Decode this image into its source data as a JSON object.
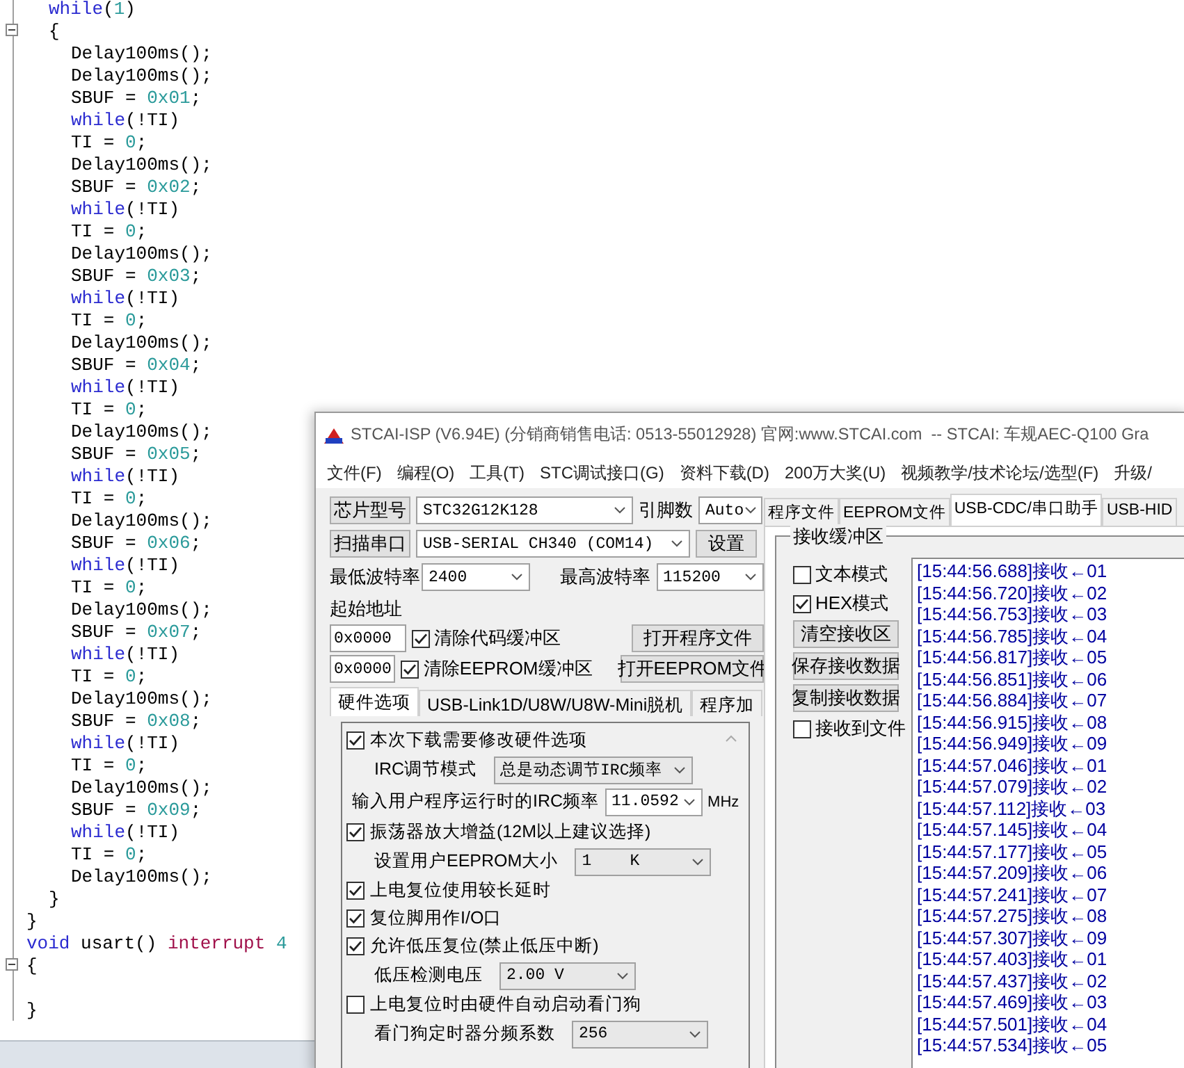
{
  "code": {
    "lines": [
      {
        "children": [
          {
            "tokens": [
              {
                "text": "while",
                "kind": "keyword"
              },
              {
                "text": "(",
                "kind": "plain"
              },
              {
                "text": "1",
                "kind": "number"
              },
              {
                "text": ")",
                "kind": "plain"
              }
            ]
          },
          {
            "tokens": [
              {
                "text": "{",
                "kind": "plain"
              }
            ],
            "expanded": true,
            "children": [
              {
                "tokens": [
                  {
                    "text": "Delay100ms();",
                    "kind": "plain"
                  }
                ]
              },
              {
                "tokens": [
                  {
                    "text": "Delay100ms();",
                    "kind": "plain"
                  }
                ]
              },
              {
                "tokens": [
                  {
                    "text": "SBUF = ",
                    "kind": "plain"
                  },
                  {
                    "text": "0x01",
                    "kind": "number"
                  },
                  {
                    "text": ";",
                    "kind": "plain"
                  }
                ]
              },
              {
                "tokens": [
                  {
                    "text": "while",
                    "kind": "keyword"
                  },
                  {
                    "text": "(!TI)",
                    "kind": "plain"
                  }
                ]
              },
              {
                "tokens": [
                  {
                    "text": "TI = ",
                    "kind": "plain"
                  },
                  {
                    "text": "0",
                    "kind": "number"
                  },
                  {
                    "text": ";",
                    "kind": "plain"
                  }
                ]
              },
              {
                "tokens": [
                  {
                    "text": "Delay100ms();",
                    "kind": "plain"
                  }
                ]
              },
              {
                "tokens": [
                  {
                    "text": "SBUF = ",
                    "kind": "plain"
                  },
                  {
                    "text": "0x02",
                    "kind": "number"
                  },
                  {
                    "text": ";",
                    "kind": "plain"
                  }
                ]
              },
              {
                "tokens": [
                  {
                    "text": "while",
                    "kind": "keyword"
                  },
                  {
                    "text": "(!TI)",
                    "kind": "plain"
                  }
                ]
              },
              {
                "tokens": [
                  {
                    "text": "TI = ",
                    "kind": "plain"
                  },
                  {
                    "text": "0",
                    "kind": "number"
                  },
                  {
                    "text": ";",
                    "kind": "plain"
                  }
                ]
              },
              {
                "tokens": [
                  {
                    "text": "Delay100ms();",
                    "kind": "plain"
                  }
                ]
              },
              {
                "tokens": [
                  {
                    "text": "SBUF = ",
                    "kind": "plain"
                  },
                  {
                    "text": "0x03",
                    "kind": "number"
                  },
                  {
                    "text": ";",
                    "kind": "plain"
                  }
                ]
              },
              {
                "tokens": [
                  {
                    "text": "while",
                    "kind": "keyword"
                  },
                  {
                    "text": "(!TI)",
                    "kind": "plain"
                  }
                ]
              },
              {
                "tokens": [
                  {
                    "text": "TI = ",
                    "kind": "plain"
                  },
                  {
                    "text": "0",
                    "kind": "number"
                  },
                  {
                    "text": ";",
                    "kind": "plain"
                  }
                ]
              },
              {
                "tokens": [
                  {
                    "text": "Delay100ms();",
                    "kind": "plain"
                  }
                ]
              },
              {
                "tokens": [
                  {
                    "text": "SBUF = ",
                    "kind": "plain"
                  },
                  {
                    "text": "0x04",
                    "kind": "number"
                  },
                  {
                    "text": ";",
                    "kind": "plain"
                  }
                ]
              },
              {
                "tokens": [
                  {
                    "text": "while",
                    "kind": "keyword"
                  },
                  {
                    "text": "(!TI)",
                    "kind": "plain"
                  }
                ]
              },
              {
                "tokens": [
                  {
                    "text": "TI = ",
                    "kind": "plain"
                  },
                  {
                    "text": "0",
                    "kind": "number"
                  },
                  {
                    "text": ";",
                    "kind": "plain"
                  }
                ]
              },
              {
                "tokens": [
                  {
                    "text": "Delay100ms();",
                    "kind": "plain"
                  }
                ]
              },
              {
                "tokens": [
                  {
                    "text": "SBUF = ",
                    "kind": "plain"
                  },
                  {
                    "text": "0x05",
                    "kind": "number"
                  },
                  {
                    "text": ";",
                    "kind": "plain"
                  }
                ]
              },
              {
                "tokens": [
                  {
                    "text": "while",
                    "kind": "keyword"
                  },
                  {
                    "text": "(!TI)",
                    "kind": "plain"
                  }
                ]
              },
              {
                "tokens": [
                  {
                    "text": "TI = ",
                    "kind": "plain"
                  },
                  {
                    "text": "0",
                    "kind": "number"
                  },
                  {
                    "text": ";",
                    "kind": "plain"
                  }
                ]
              },
              {
                "tokens": [
                  {
                    "text": "Delay100ms();",
                    "kind": "plain"
                  }
                ]
              },
              {
                "tokens": [
                  {
                    "text": "SBUF = ",
                    "kind": "plain"
                  },
                  {
                    "text": "0x06",
                    "kind": "number"
                  },
                  {
                    "text": ";",
                    "kind": "plain"
                  }
                ]
              },
              {
                "tokens": [
                  {
                    "text": "while",
                    "kind": "keyword"
                  },
                  {
                    "text": "(!TI)",
                    "kind": "plain"
                  }
                ]
              },
              {
                "tokens": [
                  {
                    "text": "TI = ",
                    "kind": "plain"
                  },
                  {
                    "text": "0",
                    "kind": "number"
                  },
                  {
                    "text": ";",
                    "kind": "plain"
                  }
                ]
              },
              {
                "tokens": [
                  {
                    "text": "Delay100ms();",
                    "kind": "plain"
                  }
                ]
              },
              {
                "tokens": [
                  {
                    "text": "SBUF = ",
                    "kind": "plain"
                  },
                  {
                    "text": "0x07",
                    "kind": "number"
                  },
                  {
                    "text": ";",
                    "kind": "plain"
                  }
                ]
              },
              {
                "tokens": [
                  {
                    "text": "while",
                    "kind": "keyword"
                  },
                  {
                    "text": "(!TI)",
                    "kind": "plain"
                  }
                ]
              },
              {
                "tokens": [
                  {
                    "text": "TI = ",
                    "kind": "plain"
                  },
                  {
                    "text": "0",
                    "kind": "number"
                  },
                  {
                    "text": ";",
                    "kind": "plain"
                  }
                ]
              },
              {
                "tokens": [
                  {
                    "text": "Delay100ms();",
                    "kind": "plain"
                  }
                ]
              },
              {
                "tokens": [
                  {
                    "text": "SBUF = ",
                    "kind": "plain"
                  },
                  {
                    "text": "0x08",
                    "kind": "number"
                  },
                  {
                    "text": ";",
                    "kind": "plain"
                  }
                ]
              },
              {
                "tokens": [
                  {
                    "text": "while",
                    "kind": "keyword"
                  },
                  {
                    "text": "(!TI)",
                    "kind": "plain"
                  }
                ]
              },
              {
                "tokens": [
                  {
                    "text": "TI = ",
                    "kind": "plain"
                  },
                  {
                    "text": "0",
                    "kind": "number"
                  },
                  {
                    "text": ";",
                    "kind": "plain"
                  }
                ]
              },
              {
                "tokens": [
                  {
                    "text": "Delay100ms();",
                    "kind": "plain"
                  }
                ]
              },
              {
                "tokens": [
                  {
                    "text": "SBUF = ",
                    "kind": "plain"
                  },
                  {
                    "text": "0x09",
                    "kind": "number"
                  },
                  {
                    "text": ";",
                    "kind": "plain"
                  }
                ]
              },
              {
                "tokens": [
                  {
                    "text": "while",
                    "kind": "keyword"
                  },
                  {
                    "text": "(!TI)",
                    "kind": "plain"
                  }
                ]
              },
              {
                "tokens": [
                  {
                    "text": "TI = ",
                    "kind": "plain"
                  },
                  {
                    "text": "0",
                    "kind": "number"
                  },
                  {
                    "text": ";",
                    "kind": "plain"
                  }
                ]
              },
              {
                "tokens": [
                  {
                    "text": "Delay100ms();",
                    "kind": "plain"
                  }
                ]
              }
            ]
          },
          {
            "tokens": [
              {
                "text": "}",
                "kind": "plain"
              }
            ]
          }
        ]
      },
      {
        "tokens": [
          {
            "text": "}",
            "kind": "plain"
          }
        ]
      },
      {
        "tokens": [
          {
            "text": "void",
            "kind": "keyword"
          },
          {
            "text": " usart() ",
            "kind": "plain"
          },
          {
            "text": "interrupt",
            "kind": "directive"
          },
          {
            "text": " 4",
            "kind": "number"
          }
        ]
      },
      {
        "tokens": [
          {
            "text": "{",
            "kind": "plain"
          }
        ],
        "expanded": true
      },
      {
        "tokens": [
          {
            "text": "}",
            "kind": "plain"
          }
        ]
      }
    ]
  },
  "isp_window": {
    "title": "STCAI-ISP (V6.94E) (分销商销售电话: 0513-55012928) 官网:www.STCAI.com  -- STCAI: 车规AEC-Q100 Gra",
    "menu": [
      "文件(F)",
      "编程(O)",
      "工具(T)",
      "STC调试接口(G)",
      "资料下载(D)",
      "200万大奖(U)",
      "视频教学/技术论坛/选型(F)",
      "升级/"
    ],
    "chip": {
      "button": "芯片型号",
      "value": "STC32G12K128",
      "pins_label": "引脚数",
      "pins_value": "Auto"
    },
    "port": {
      "button": "扫描串口",
      "value": "USB-SERIAL CH340 (COM14)",
      "settings_button": "设置"
    },
    "baud": {
      "min_label": "最低波特率",
      "min_value": "2400",
      "max_label": "最高波特率",
      "max_value": "115200"
    },
    "start_address": {
      "label": "起始地址",
      "rows": [
        {
          "value": "0x0000",
          "checkbox": "清除代码缓冲区",
          "checked": true,
          "button": "打开程序文件"
        },
        {
          "value": "0x0000",
          "checkbox": "清除EEPROM缓冲区",
          "checked": true,
          "button": "打开EEPROM文件"
        }
      ]
    },
    "option_tabs": [
      {
        "label": "硬件选项",
        "selected": true
      },
      {
        "label": "USB-Link1D/U8W/U8W-Mini脱机",
        "selected": false
      },
      {
        "label": "程序加",
        "selected": false
      }
    ],
    "hardware_options": [
      {
        "kind": "checkbox",
        "label": "本次下载需要修改硬件选项",
        "checked": true
      },
      {
        "kind": "select",
        "label": "IRC调节模式",
        "value": "总是动态调节IRC频率"
      },
      {
        "kind": "combo",
        "label": "输入用户程序运行时的IRC频率",
        "value": "11.0592",
        "unit": "MHz"
      },
      {
        "kind": "checkbox",
        "label": "振荡器放大增益(12M以上建议选择)",
        "checked": true
      },
      {
        "kind": "select",
        "label": "设置用户EEPROM大小",
        "value": "1    K"
      },
      {
        "kind": "checkbox",
        "label": "上电复位使用较长延时",
        "checked": true
      },
      {
        "kind": "checkbox",
        "label": "复位脚用作I/O口",
        "checked": true
      },
      {
        "kind": "checkbox",
        "label": "允许低压复位(禁止低压中断)",
        "checked": true
      },
      {
        "kind": "select",
        "label": "低压检测电压",
        "value": "2.00 V"
      },
      {
        "kind": "checkbox",
        "label": "上电复位时由硬件自动启动看门狗",
        "checked": false
      },
      {
        "kind": "select",
        "label": "看门狗定时器分频系数",
        "value": "256"
      }
    ],
    "right_tabs": [
      {
        "label": "程序文件",
        "selected": false
      },
      {
        "label": "EEPROM文件",
        "selected": false
      },
      {
        "label": "USB-CDC/串口助手",
        "selected": true
      },
      {
        "label": "USB-HID",
        "selected": false
      }
    ],
    "receive": {
      "title": "接收缓冲区",
      "options": [
        {
          "kind": "checkbox",
          "label": "文本模式",
          "checked": false
        },
        {
          "kind": "checkbox",
          "label": "HEX模式",
          "checked": true
        },
        {
          "kind": "button",
          "label": "清空接收区"
        },
        {
          "kind": "button",
          "label": "保存接收数据"
        },
        {
          "kind": "button",
          "label": "复制接收数据"
        },
        {
          "kind": "checkbox",
          "label": "接收到文件",
          "checked": false
        }
      ],
      "log": [
        "[15:44:56.688]接收←01",
        "[15:44:56.720]接收←02",
        "[15:44:56.753]接收←03",
        "[15:44:56.785]接收←04",
        "[15:44:56.817]接收←05",
        "[15:44:56.851]接收←06",
        "[15:44:56.884]接收←07",
        "[15:44:56.915]接收←08",
        "[15:44:56.949]接收←09",
        "[15:44:57.046]接收←01",
        "[15:44:57.079]接收←02",
        "[15:44:57.112]接收←03",
        "[15:44:57.145]接收←04",
        "[15:44:57.177]接收←05",
        "[15:44:57.209]接收←06",
        "[15:44:57.241]接收←07",
        "[15:44:57.275]接收←08",
        "[15:44:57.307]接收←09",
        "[15:44:57.403]接收←01",
        "[15:44:57.437]接收←02",
        "[15:44:57.469]接收←03",
        "[15:44:57.501]接收←04",
        "[15:44:57.534]接收←05"
      ]
    }
  }
}
